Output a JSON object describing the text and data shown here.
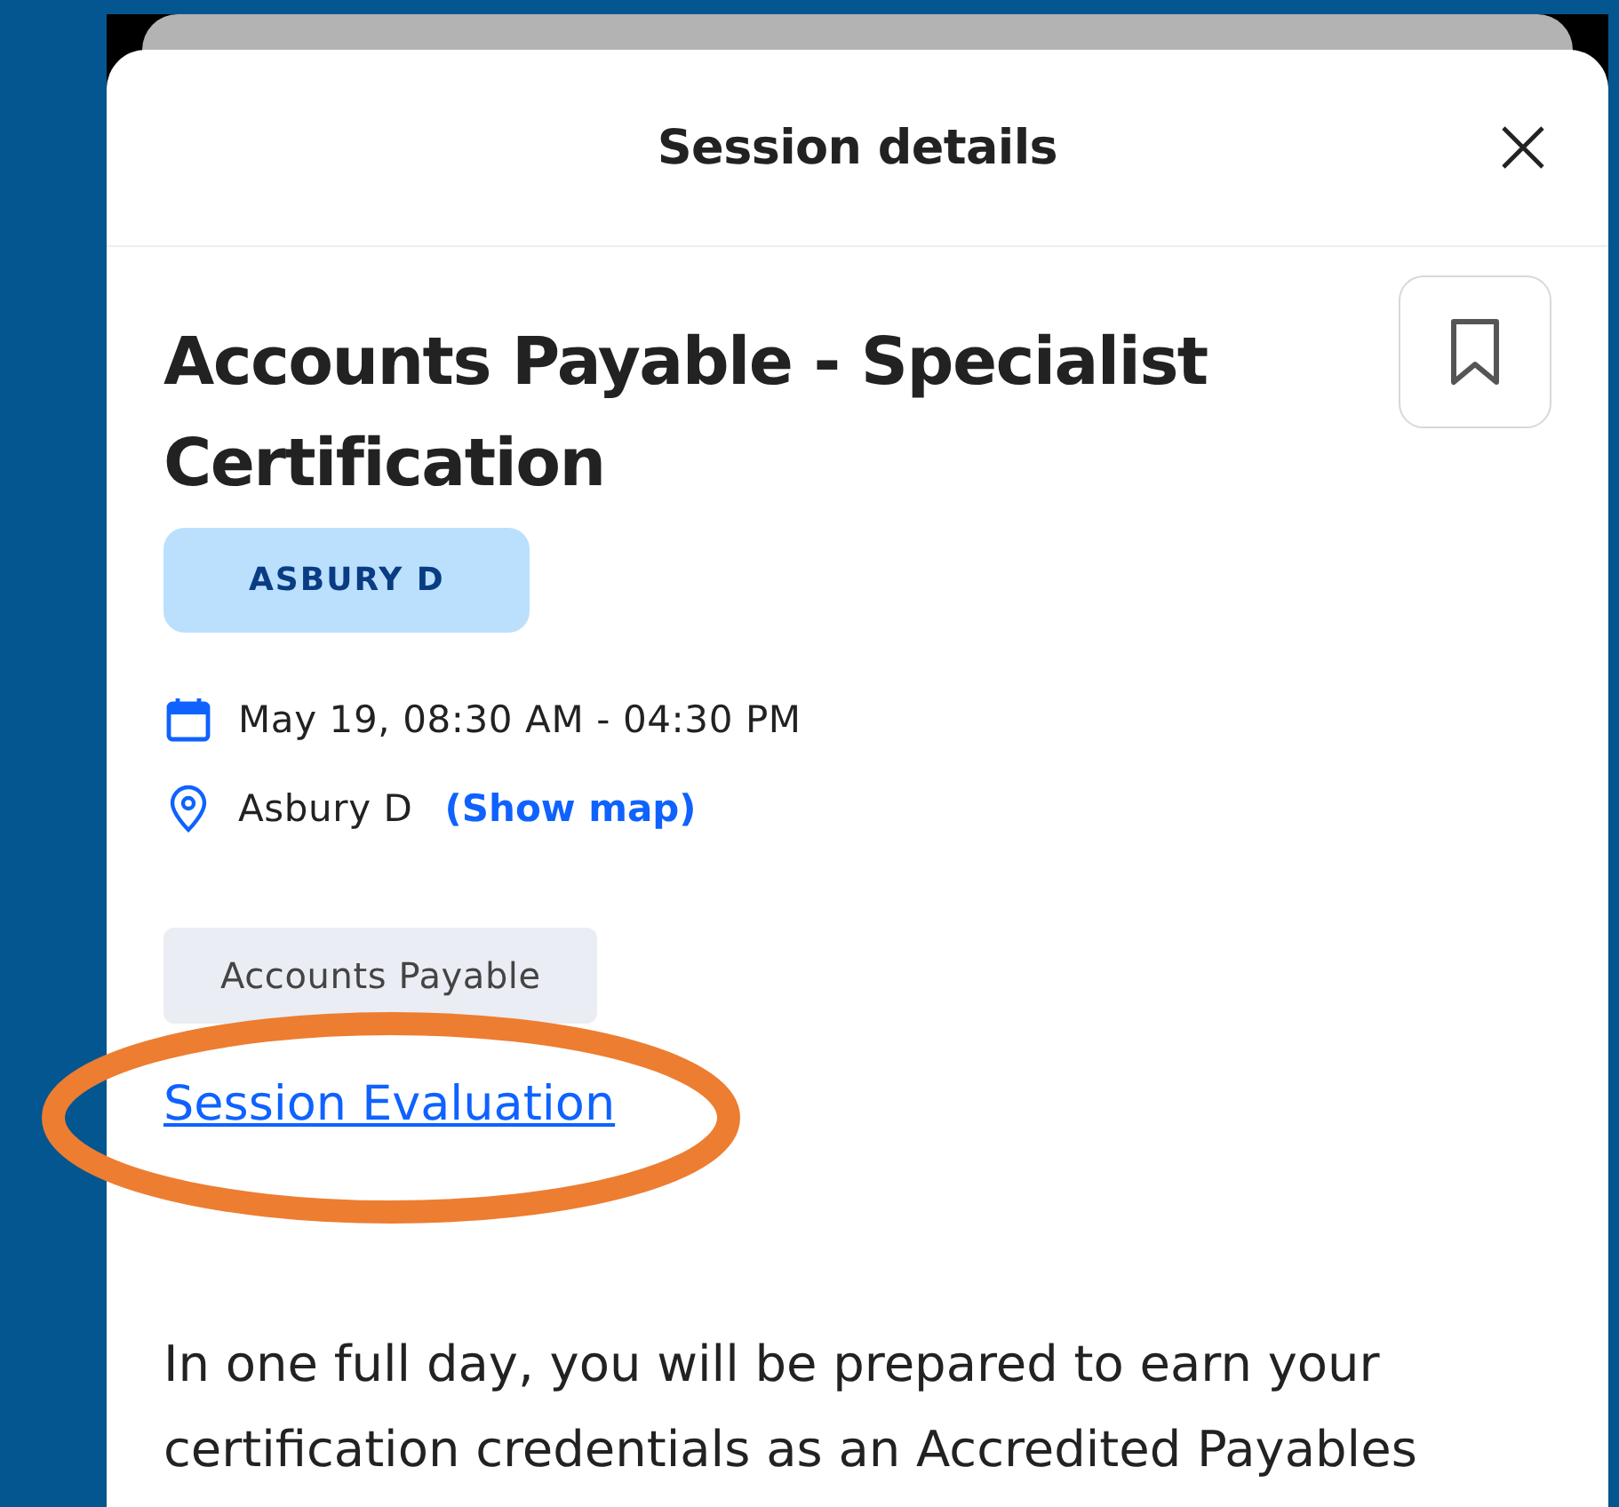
{
  "sheet": {
    "title": "Session details"
  },
  "session": {
    "title": "Accounts Payable - Specialist Certification",
    "bookmarked": false,
    "room_badge": "ASBURY D",
    "datetime": "May 19, 08:30 AM - 04:30 PM",
    "location": "Asbury D",
    "map_link": "(Show map)",
    "tags": [
      "Accounts Payable"
    ],
    "evaluation_link": "Session Evaluation",
    "description": "In one full day, you will be prepared to earn your certification credentials as an Accredited Payables"
  },
  "annotation": {
    "kind": "ellipse",
    "color": "#ed7d31"
  }
}
